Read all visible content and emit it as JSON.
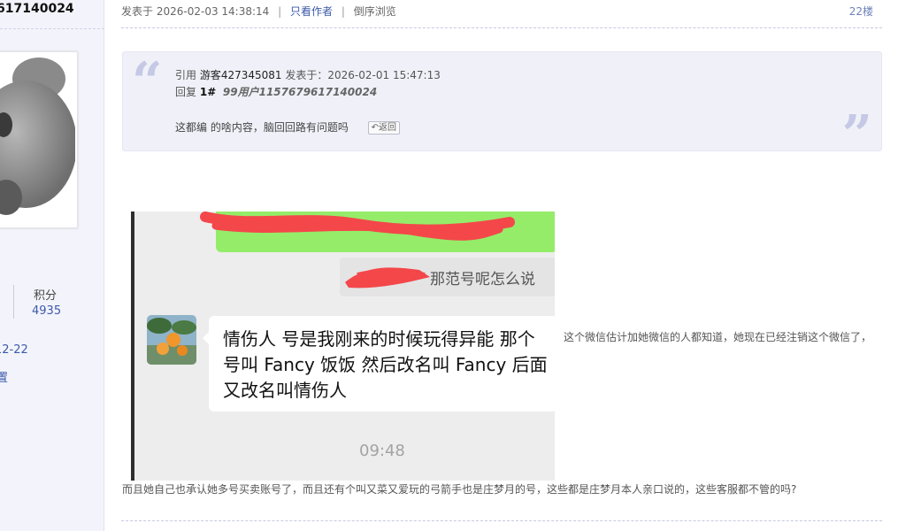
{
  "sidebar": {
    "author_name": "617140024",
    "stat_label": "积分",
    "stat_value": "4935",
    "date_fragment": "12-22",
    "link_fragment": "置"
  },
  "post": {
    "posted_label": "发表于",
    "posted_time": "2026-02-03 14:38:14",
    "only_author": "只看作者",
    "reverse_order": "倒序浏览",
    "floor": "22楼"
  },
  "quote": {
    "prefix": "引用",
    "user": "游客427345081",
    "posted": "发表于：2026-02-01 15:47:13",
    "reply_label": "回复",
    "reply_floor": "1#",
    "reply_target": "99用户1157679617140024",
    "text": "这都编 的啥内容，脑回回路有问题吗",
    "back_label": "返回"
  },
  "chat": {
    "reply_bubble": "那范号呢怎么说",
    "message": "情伤人  号是我刚来的时候玩得异能  那个号叫 Fancy 饭饭  然后改名叫 Fancy 后面又改名叫情伤人",
    "time": "09:48"
  },
  "content": {
    "side_text": "这个微信估计加她微信的人都知道，她现在已经注销这个微信了，",
    "body_text": "而且她自己也承认她多号买卖账号了，而且还有个叫又菜又爱玩的弓箭手也是庄梦月的号，这些都是庄梦月本人亲口说的，这些客服都不管的吗?"
  },
  "colors": {
    "link": "#3d5aa8",
    "quote_bg": "#f0f1f8",
    "wechat_green": "#95ec69",
    "scribble_red": "#f4474a"
  }
}
